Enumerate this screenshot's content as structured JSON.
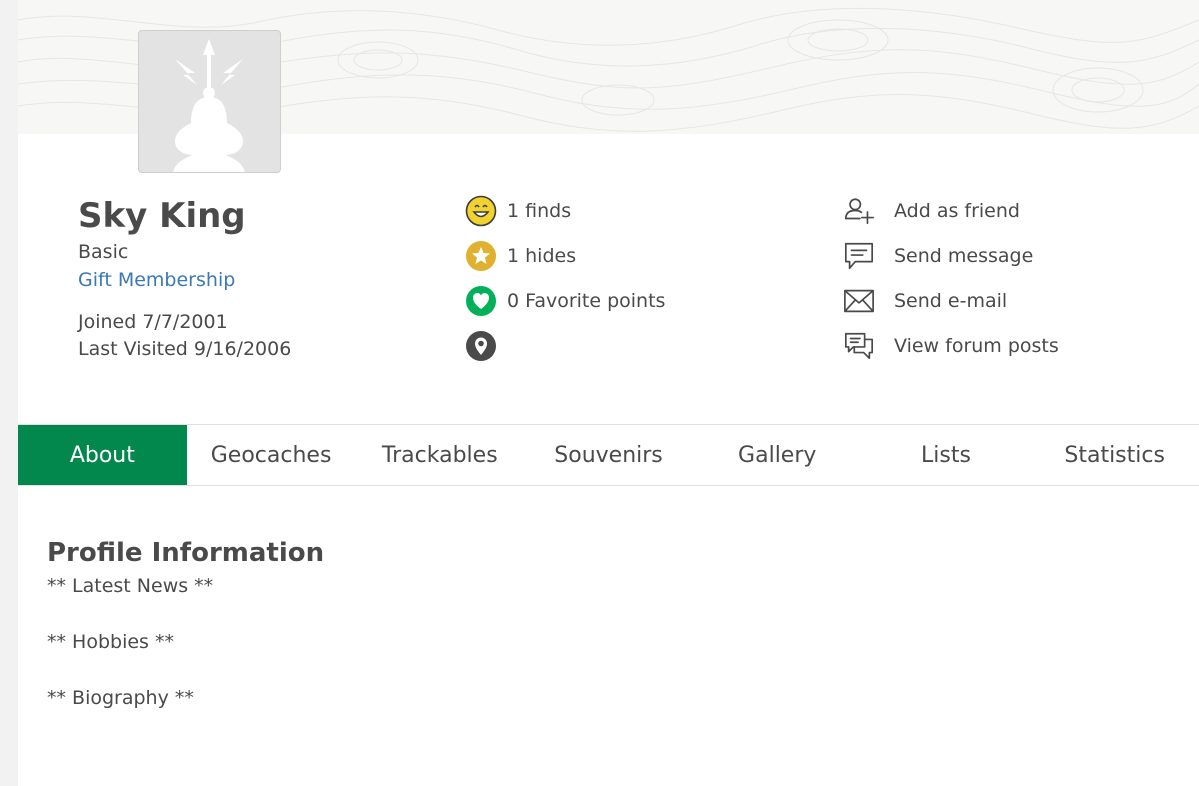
{
  "profile": {
    "name": "Sky King",
    "membership": "Basic",
    "gift_link": "Gift Membership",
    "joined": "Joined 7/7/2001",
    "last_visited": "Last Visited 9/16/2006"
  },
  "stats": {
    "finds": "1 finds",
    "hides": "1 hides",
    "favorites": "0 Favorite points",
    "location": ""
  },
  "actions": {
    "add_friend": "Add as friend",
    "send_message": "Send message",
    "send_email": "Send e-mail",
    "forum_posts": "View forum posts"
  },
  "tabs": [
    {
      "label": "About",
      "active": true
    },
    {
      "label": "Geocaches"
    },
    {
      "label": "Trackables"
    },
    {
      "label": "Souvenirs"
    },
    {
      "label": "Gallery"
    },
    {
      "label": "Lists"
    },
    {
      "label": "Statistics"
    }
  ],
  "profile_info": {
    "title": "Profile Information",
    "latest_news": "** Latest News **",
    "hobbies": "** Hobbies **",
    "biography": "** Biography **"
  },
  "colors": {
    "accent_green": "#02874d",
    "link_blue": "#3c78b4",
    "finds_yellow": "#f2d22e",
    "hides_gold": "#e0b030",
    "favorites_green": "#02b05a"
  },
  "icons": {
    "finds": "smiley-icon",
    "hides": "star-icon",
    "favorites": "heart-icon",
    "location": "map-pin-icon",
    "add_friend": "add-user-icon",
    "send_message": "message-icon",
    "send_email": "envelope-icon",
    "forum_posts": "forum-icon"
  }
}
